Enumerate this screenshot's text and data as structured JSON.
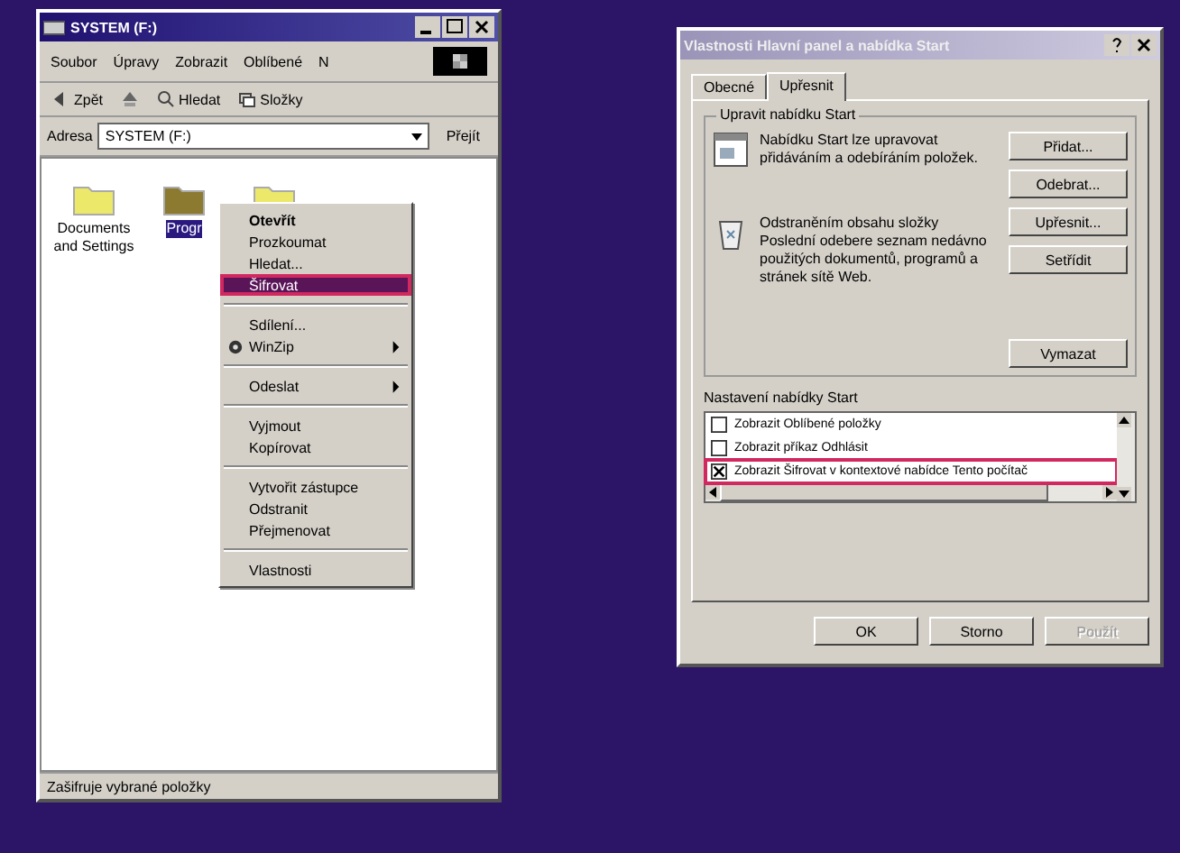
{
  "explorer": {
    "title": "SYSTEM (F:)",
    "menu": [
      "Soubor",
      "Úpravy",
      "Zobrazit",
      "Oblíbené",
      "N"
    ],
    "toolbar": [
      {
        "kind": "back",
        "label": "Zpět"
      },
      {
        "kind": "up"
      },
      {
        "kind": "search",
        "label": "Hledat"
      },
      {
        "kind": "folders",
        "label": "Složky"
      }
    ],
    "address": {
      "label": "Adresa",
      "value": "SYSTEM (F:)",
      "go": "Přejít"
    },
    "folders": [
      {
        "name": "Documents and Settings",
        "selected": false
      },
      {
        "name": "Progr",
        "selected": true
      },
      {
        "selected": false
      }
    ],
    "context_menu": [
      {
        "kind": "item",
        "label": "Otevřít",
        "bold": true,
        "annotated": false,
        "submenu": false
      },
      {
        "kind": "item",
        "label": "Prozkoumat",
        "bold": false,
        "annotated": false,
        "submenu": false
      },
      {
        "kind": "item",
        "label": "Hledat...",
        "bold": false,
        "annotated": false,
        "submenu": false
      },
      {
        "kind": "item",
        "label": "Šifrovat",
        "bold": false,
        "annotated": true,
        "submenu": false
      },
      {
        "kind": "separator"
      },
      {
        "kind": "item",
        "label": "Sdílení...",
        "bold": false,
        "annotated": false,
        "submenu": false
      },
      {
        "kind": "icon-item",
        "label": "WinZip",
        "bold": false,
        "annotated": false,
        "submenu": true
      },
      {
        "kind": "separator"
      },
      {
        "kind": "item",
        "label": "Odeslat",
        "bold": false,
        "annotated": false,
        "submenu": true
      },
      {
        "kind": "separator"
      },
      {
        "kind": "item",
        "label": "Vyjmout",
        "bold": false,
        "annotated": false,
        "submenu": false
      },
      {
        "kind": "item",
        "label": "Kopírovat",
        "bold": false,
        "annotated": false,
        "submenu": false
      },
      {
        "kind": "separator"
      },
      {
        "kind": "item",
        "label": "Vytvořit zástupce",
        "bold": false,
        "annotated": false,
        "submenu": false
      },
      {
        "kind": "item",
        "label": "Odstranit",
        "bold": false,
        "annotated": false,
        "submenu": false
      },
      {
        "kind": "item",
        "label": "Přejmenovat",
        "bold": false,
        "annotated": false,
        "submenu": false
      },
      {
        "kind": "separator"
      },
      {
        "kind": "item",
        "label": "Vlastnosti",
        "bold": false,
        "annotated": false,
        "submenu": false
      }
    ],
    "status_bar": "Zašifruje vybrané položky"
  },
  "dialog": {
    "title": "Vlastnosti Hlavní panel a nabídka Start",
    "tabs": [
      {
        "label": "Obecné",
        "selected": false
      },
      {
        "label": "Upřesnit",
        "selected": true
      }
    ],
    "group1": {
      "title": "Upravit nabídku Start",
      "text1": "Nabídku Start lze upravovat přidáváním a odebíráním položek.",
      "buttons": [
        "Přidat...",
        "Odebrat...",
        "Upřesnit...",
        "Setřídit"
      ],
      "text2": "Odstraněním obsahu složky Poslední odebere seznam nedávno použitých dokumentů, programů a stránek sítě Web.",
      "clear": "Vymazat"
    },
    "settings": {
      "title": "Nastavení nabídky Start",
      "rows": [
        {
          "label": "Zobrazit Oblíbené položky",
          "checked": false,
          "annotated": false
        },
        {
          "label": "Zobrazit příkaz Odhlásit",
          "checked": false,
          "annotated": false
        },
        {
          "label": "Zobrazit Šifrovat v kontextové nabídce Tento počítač",
          "checked": true,
          "annotated": true
        }
      ]
    },
    "buttons": [
      {
        "label": "OK",
        "disabled": false
      },
      {
        "label": "Storno",
        "disabled": false
      },
      {
        "label": "Použít",
        "disabled": true
      }
    ]
  }
}
